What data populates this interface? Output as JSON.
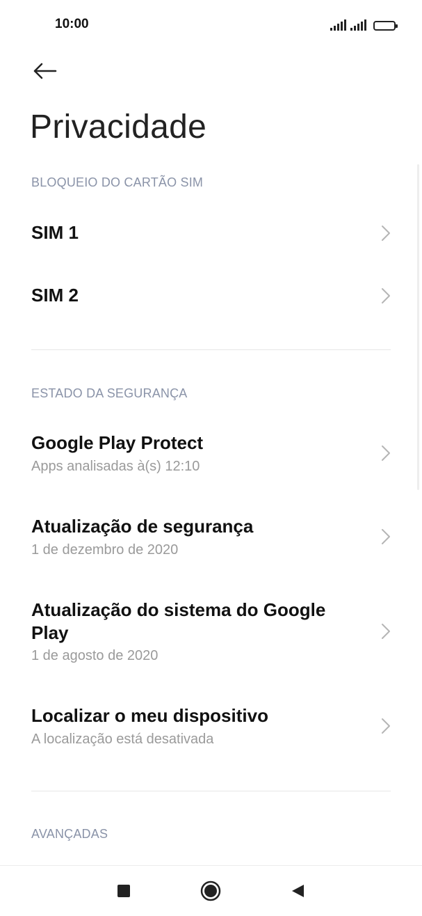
{
  "status_bar": {
    "time": "10:00"
  },
  "header": {
    "back_icon": "arrow-left-icon",
    "title": "Privacidade"
  },
  "sections": [
    {
      "header": "BLOQUEIO DO CARTÃO SIM",
      "items": [
        {
          "title": "SIM 1",
          "subtitle": ""
        },
        {
          "title": "SIM 2",
          "subtitle": ""
        }
      ]
    },
    {
      "header": "ESTADO DA SEGURANÇA",
      "items": [
        {
          "title": "Google Play Protect",
          "subtitle": "Apps analisadas à(s) 12:10"
        },
        {
          "title": "Atualização de segurança",
          "subtitle": "1 de dezembro de 2020"
        },
        {
          "title": "Atualização do sistema do Google Play",
          "subtitle": "1 de agosto de 2020"
        },
        {
          "title": "Localizar o meu dispositivo",
          "subtitle": "A localização está desativada"
        }
      ]
    },
    {
      "header": "AVANÇADAS",
      "items": []
    }
  ],
  "nav_bar": {
    "recents_icon": "square-recents-icon",
    "home_icon": "circle-home-icon",
    "back_icon": "triangle-back-icon"
  },
  "colors": {
    "section_header": "#8a93a8",
    "subtitle": "#9a9a9a",
    "chevron": "#b5b5b5"
  }
}
